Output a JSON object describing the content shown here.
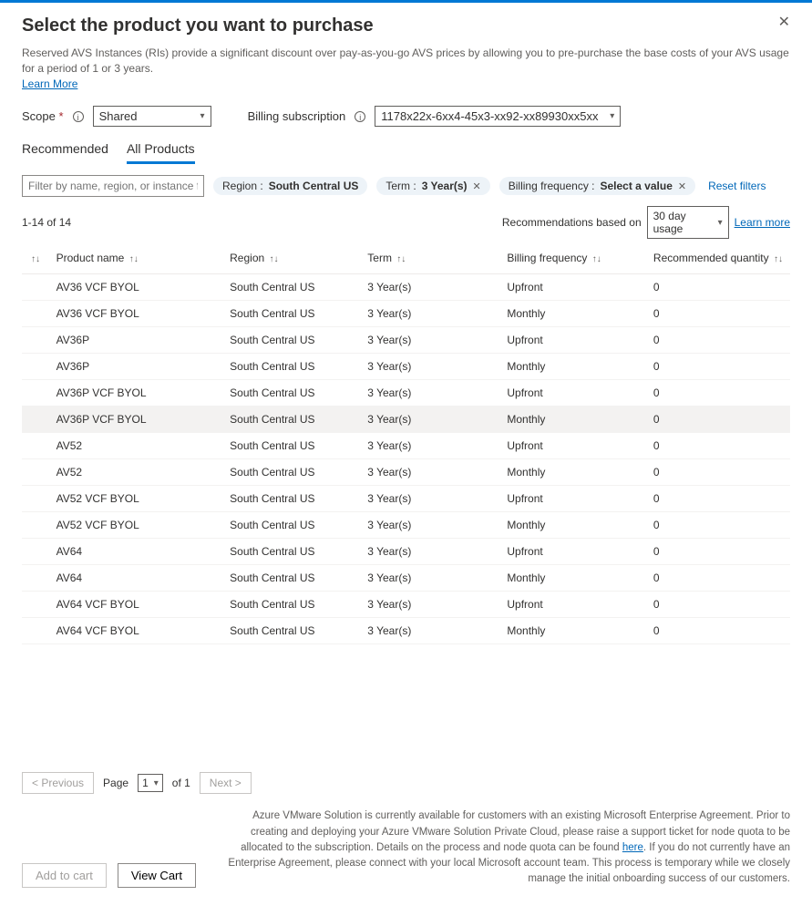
{
  "header": {
    "title": "Select the product you want to purchase",
    "close_icon": "close-icon"
  },
  "intro": {
    "text": "Reserved AVS Instances (RIs) provide a significant discount over pay-as-you-go AVS prices by allowing you to pre-purchase the base costs of your AVS usage for a period of 1 or 3 years.",
    "learn_more": "Learn More"
  },
  "form": {
    "scope_label": "Scope",
    "scope_value": "Shared",
    "billing_label": "Billing subscription",
    "billing_value": "1178x22x-6xx4-45x3-xx92-xx89930xx5xx"
  },
  "tabs": {
    "recommended": "Recommended",
    "all_products": "All Products"
  },
  "filters": {
    "placeholder": "Filter by name, region, or instance flexi...",
    "region_pill_prefix": "Region : ",
    "region_pill_value": "South Central US",
    "term_pill_prefix": "Term : ",
    "term_pill_value": "3 Year(s)",
    "freq_pill_prefix": "Billing frequency : ",
    "freq_pill_value": "Select a value",
    "reset": "Reset filters"
  },
  "meta": {
    "count": "1-14 of 14",
    "reco_label": "Recommendations based on",
    "usage_value": "30 day usage",
    "learn_more": "Learn more"
  },
  "columns": {
    "name": "Product name",
    "region": "Region",
    "term": "Term",
    "bill": "Billing frequency",
    "qty": "Recommended quantity"
  },
  "rows": [
    {
      "name": "AV36 VCF BYOL",
      "region": "South Central US",
      "term": "3 Year(s)",
      "bill": "Upfront",
      "qty": "0",
      "hover": false
    },
    {
      "name": "AV36 VCF BYOL",
      "region": "South Central US",
      "term": "3 Year(s)",
      "bill": "Monthly",
      "qty": "0",
      "hover": false
    },
    {
      "name": "AV36P",
      "region": "South Central US",
      "term": "3 Year(s)",
      "bill": "Upfront",
      "qty": "0",
      "hover": false
    },
    {
      "name": "AV36P",
      "region": "South Central US",
      "term": "3 Year(s)",
      "bill": "Monthly",
      "qty": "0",
      "hover": false
    },
    {
      "name": "AV36P VCF BYOL",
      "region": "South Central US",
      "term": "3 Year(s)",
      "bill": "Upfront",
      "qty": "0",
      "hover": false
    },
    {
      "name": "AV36P VCF BYOL",
      "region": "South Central US",
      "term": "3 Year(s)",
      "bill": "Monthly",
      "qty": "0",
      "hover": true
    },
    {
      "name": "AV52",
      "region": "South Central US",
      "term": "3 Year(s)",
      "bill": "Upfront",
      "qty": "0",
      "hover": false
    },
    {
      "name": "AV52",
      "region": "South Central US",
      "term": "3 Year(s)",
      "bill": "Monthly",
      "qty": "0",
      "hover": false
    },
    {
      "name": "AV52 VCF BYOL",
      "region": "South Central US",
      "term": "3 Year(s)",
      "bill": "Upfront",
      "qty": "0",
      "hover": false
    },
    {
      "name": "AV52 VCF BYOL",
      "region": "South Central US",
      "term": "3 Year(s)",
      "bill": "Monthly",
      "qty": "0",
      "hover": false
    },
    {
      "name": "AV64",
      "region": "South Central US",
      "term": "3 Year(s)",
      "bill": "Upfront",
      "qty": "0",
      "hover": false
    },
    {
      "name": "AV64",
      "region": "South Central US",
      "term": "3 Year(s)",
      "bill": "Monthly",
      "qty": "0",
      "hover": false
    },
    {
      "name": "AV64 VCF BYOL",
      "region": "South Central US",
      "term": "3 Year(s)",
      "bill": "Upfront",
      "qty": "0",
      "hover": false
    },
    {
      "name": "AV64 VCF BYOL",
      "region": "South Central US",
      "term": "3 Year(s)",
      "bill": "Monthly",
      "qty": "0",
      "hover": false
    }
  ],
  "pagination": {
    "previous": "< Previous",
    "page_label": "Page",
    "page_value": "1",
    "of": "of 1",
    "next": "Next >"
  },
  "footer": {
    "add_to_cart": "Add to cart",
    "view_cart": "View Cart",
    "text1": "Azure VMware Solution is currently available for customers with an existing Microsoft Enterprise Agreement. Prior to creating and deploying your Azure VMware Solution Private Cloud, please raise a support ticket for node quota to be allocated to the subscription. Details on the process and node quota can be found ",
    "here": "here",
    "text2": ". If you do not currently have an Enterprise Agreement, please connect with your local Microsoft account team. This process is temporary while we closely manage the initial onboarding success of our customers."
  }
}
